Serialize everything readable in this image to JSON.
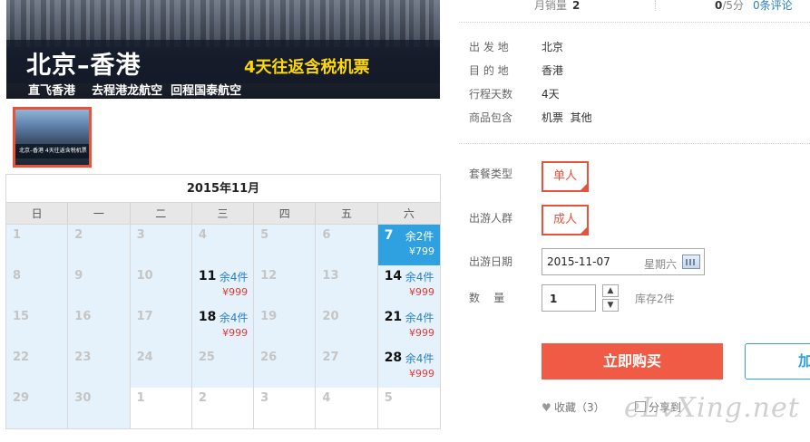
{
  "banner": {
    "title": "北京–香港",
    "promo": "4天往返含税机票",
    "subtitle": "直飞香港    去程港龙航空  回程国泰航空"
  },
  "thumbnail": {
    "caption": "北京–香港 4天往返含税机票"
  },
  "calendar": {
    "month_title": "2015年11月",
    "weekdays": [
      "日",
      "一",
      "二",
      "三",
      "四",
      "五",
      "六"
    ],
    "weeks": [
      [
        {
          "d": "1"
        },
        {
          "d": "2"
        },
        {
          "d": "3"
        },
        {
          "d": "4"
        },
        {
          "d": "5"
        },
        {
          "d": "6"
        },
        {
          "d": "7",
          "stock": "余2件",
          "price": "¥799",
          "sel": true
        }
      ],
      [
        {
          "d": "8"
        },
        {
          "d": "9"
        },
        {
          "d": "10"
        },
        {
          "d": "11",
          "stock": "余4件",
          "price": "¥999"
        },
        {
          "d": "12"
        },
        {
          "d": "13"
        },
        {
          "d": "14",
          "stock": "余4件",
          "price": "¥999"
        }
      ],
      [
        {
          "d": "15"
        },
        {
          "d": "16"
        },
        {
          "d": "17"
        },
        {
          "d": "18",
          "stock": "余4件",
          "price": "¥999"
        },
        {
          "d": "19"
        },
        {
          "d": "20"
        },
        {
          "d": "21",
          "stock": "余4件",
          "price": "¥999"
        }
      ],
      [
        {
          "d": "22"
        },
        {
          "d": "23"
        },
        {
          "d": "24"
        },
        {
          "d": "25"
        },
        {
          "d": "26"
        },
        {
          "d": "27"
        },
        {
          "d": "28",
          "stock": "余4件",
          "price": "¥999"
        }
      ],
      [
        {
          "d": "29"
        },
        {
          "d": "30"
        },
        {
          "d": "1",
          "other": true
        },
        {
          "d": "2",
          "other": true
        },
        {
          "d": "3",
          "other": true
        },
        {
          "d": "4",
          "other": true
        },
        {
          "d": "5",
          "other": true
        }
      ]
    ]
  },
  "stats": {
    "sales_label": "月销量",
    "sales_value": "2",
    "rating_value": "0",
    "rating_suffix": "/5分",
    "reviews": "0条评论"
  },
  "info": {
    "departure_label": "出 发 地",
    "departure": "北京",
    "destination_label": "目 的 地",
    "destination": "香港",
    "days_label": "行程天数",
    "days": "4天",
    "includes_label": "商品包含",
    "includes": "机票  其他"
  },
  "options": {
    "package_label": "套餐类型",
    "package_value": "单人",
    "group_label": "出游人群",
    "group_value": "成人",
    "date_label": "出游日期",
    "date_value": "2015-11-07",
    "date_weekday": "星期六",
    "qty_label": "数    量",
    "qty_value": "1",
    "stock": "库存2件",
    "qty_up": "▲",
    "qty_down": "▼"
  },
  "actions": {
    "buy": "立即购买",
    "cart": "加",
    "favorite": "收藏（3）",
    "share": "分享到"
  },
  "watermark": "eLvXing.net",
  "colors": {
    "accent": "#f05b45",
    "selected_day": "#2fa0e0",
    "available_bg": "#e5f2fb",
    "price": "#e23a3a"
  }
}
